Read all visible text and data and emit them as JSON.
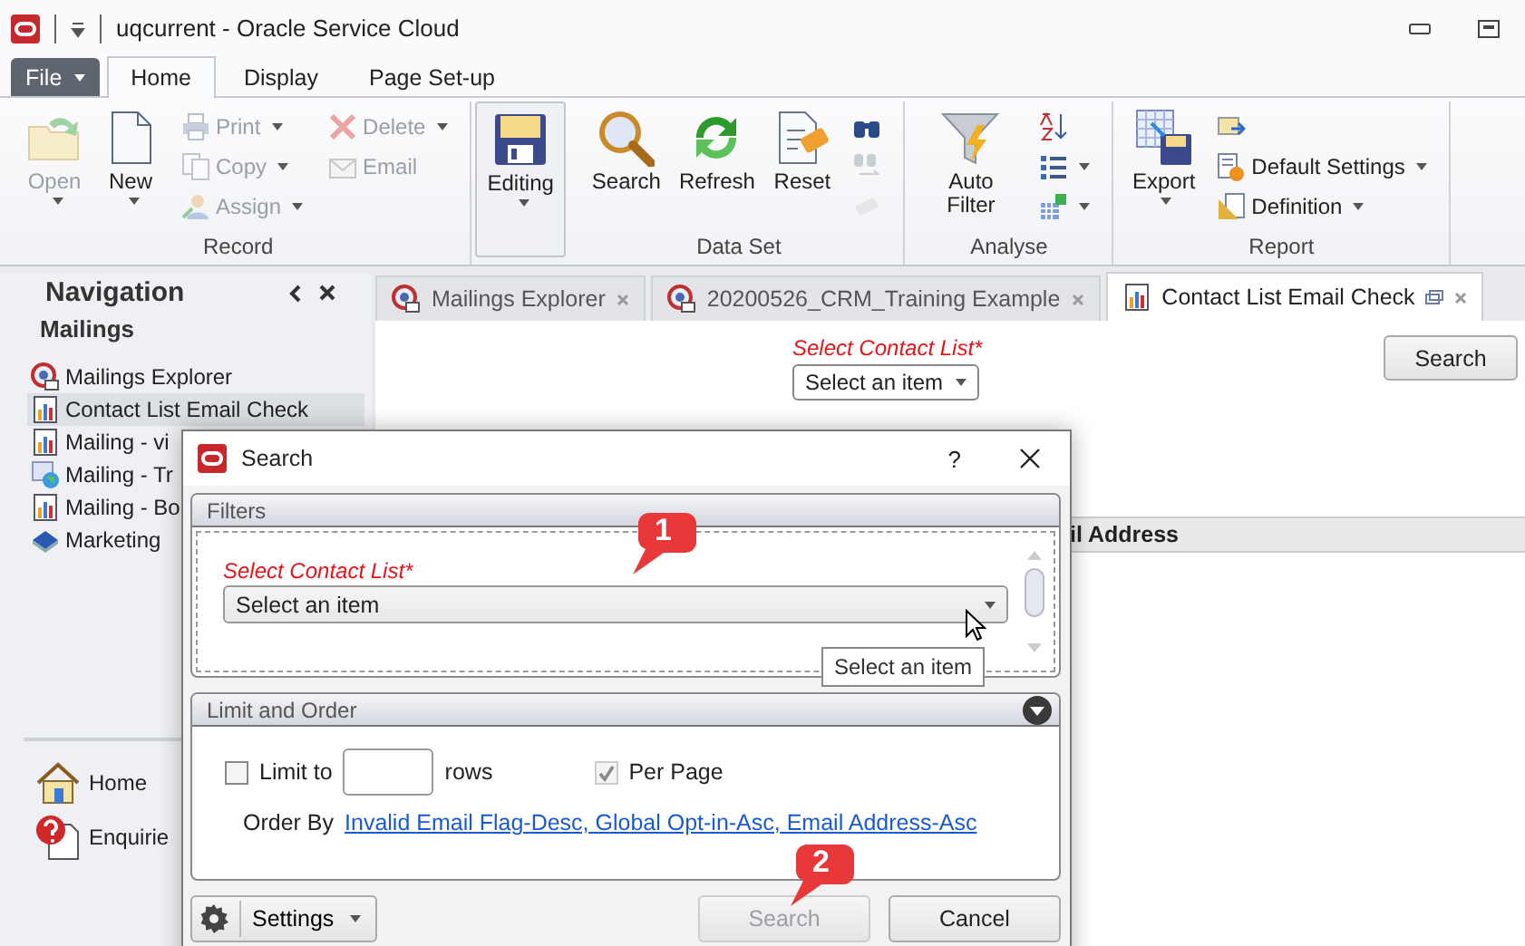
{
  "window": {
    "title": "uqcurrent  -  Oracle Service Cloud"
  },
  "ribbon": {
    "tabs": [
      {
        "label": "File",
        "kind": "menu"
      },
      {
        "label": "Home",
        "kind": "tab",
        "selected": true
      },
      {
        "label": "Display",
        "kind": "tab",
        "selected": false
      },
      {
        "label": "Page Set-up",
        "kind": "tab",
        "selected": false
      }
    ],
    "groups": [
      {
        "label": "Record",
        "kind": "group",
        "items": [
          {
            "kind": "large",
            "label": "Open",
            "disabled": true,
            "dropdown": true
          },
          {
            "kind": "large",
            "label": "New",
            "disabled": false,
            "dropdown": true
          },
          {
            "kind": "small",
            "label": "Print",
            "disabled": true,
            "dropdown": true
          },
          {
            "kind": "small",
            "label": "Copy",
            "disabled": true,
            "dropdown": true
          },
          {
            "kind": "small",
            "label": "Assign",
            "disabled": true,
            "dropdown": true
          },
          {
            "kind": "small",
            "label": "Delete",
            "disabled": true,
            "dropdown": true
          },
          {
            "kind": "small",
            "label": "Email",
            "disabled": true,
            "dropdown": false
          }
        ]
      },
      {
        "kind": "framed",
        "items": [
          {
            "kind": "large",
            "label": "Editing",
            "disabled": false,
            "dropdown": true
          }
        ]
      },
      {
        "label": "Data Set",
        "kind": "group",
        "items": [
          {
            "kind": "large",
            "label": "Search",
            "disabled": false,
            "dropdown": false
          },
          {
            "kind": "large",
            "label": "Refresh",
            "disabled": false,
            "dropdown": false
          },
          {
            "kind": "large",
            "label": "Reset",
            "disabled": false,
            "dropdown": false
          },
          {
            "kind": "small",
            "disabled": false,
            "dropdown": false
          },
          {
            "kind": "small",
            "disabled": true,
            "dropdown": false
          },
          {
            "kind": "small",
            "disabled": true,
            "dropdown": false
          }
        ]
      },
      {
        "label": "Analyse",
        "kind": "group",
        "items": [
          {
            "kind": "large",
            "label": "Auto Filter",
            "disabled": false,
            "dropdown": false
          },
          {
            "kind": "small",
            "disabled": false,
            "dropdown": false
          },
          {
            "kind": "small",
            "disabled": false,
            "dropdown": true
          },
          {
            "kind": "small",
            "disabled": false,
            "dropdown": true
          }
        ]
      },
      {
        "label": "Report",
        "kind": "group",
        "items": [
          {
            "kind": "large",
            "label": "Export",
            "disabled": false,
            "dropdown": true
          },
          {
            "kind": "small",
            "disabled": false,
            "dropdown": false
          },
          {
            "kind": "small",
            "label": "Default Settings",
            "disabled": false,
            "dropdown": true
          },
          {
            "kind": "small",
            "label": "Definition",
            "disabled": false,
            "dropdown": true
          }
        ]
      }
    ]
  },
  "navigation": {
    "title": "Navigation",
    "section": "Mailings",
    "items": [
      {
        "label": "Mailings Explorer",
        "kind": "explorer",
        "selected": false
      },
      {
        "label": "Contact List Email Check",
        "kind": "report",
        "selected": true
      },
      {
        "label": "Mailing - vi",
        "kind": "report",
        "selected": false
      },
      {
        "label": "Mailing - Tr",
        "kind": "grid",
        "selected": false
      },
      {
        "label": "Mailing - Bo",
        "kind": "report",
        "selected": false
      },
      {
        "label": "Marketing",
        "kind": "book",
        "selected": false
      }
    ],
    "shortcuts": [
      {
        "label": "Home",
        "kind": "home"
      },
      {
        "label": "Enquirie",
        "kind": "enquiries"
      }
    ]
  },
  "document_tabs": [
    {
      "label": "Mailings Explorer",
      "kind": "explorer",
      "selected": false
    },
    {
      "label": "20200526_CRM_Training Example",
      "kind": "explorer",
      "selected": false
    },
    {
      "label": "Contact List Email Check",
      "kind": "report",
      "selected": true
    }
  ],
  "report_form": {
    "label": "Select Contact List*",
    "value": "Select an item",
    "button": "Search"
  },
  "grid": {
    "columns": [
      "il Address"
    ]
  },
  "dialog": {
    "title": "Search",
    "help": "?",
    "filters": {
      "title": "Filters",
      "field": {
        "label": "Select Contact List*",
        "value": "Select an item"
      }
    },
    "limit_and_order": {
      "title": "Limit and Order",
      "expanded": true,
      "limit": {
        "label": "Limit to",
        "checked": false,
        "suffix": "rows"
      },
      "per_page": {
        "label": "Per Page",
        "checked": true,
        "disabled": true
      },
      "order_by": {
        "label": "Order By",
        "link": "Invalid Email Flag-Desc, Global Opt-in-Asc, Email Address-Asc"
      }
    },
    "settings": {
      "label": "Settings"
    },
    "buttons": [
      {
        "label": "Search",
        "disabled": true
      },
      {
        "label": "Cancel",
        "disabled": false
      }
    ]
  },
  "tooltip": {
    "text": "Select an item"
  },
  "callouts": [
    {
      "label": "1"
    },
    {
      "label": "2"
    }
  ]
}
